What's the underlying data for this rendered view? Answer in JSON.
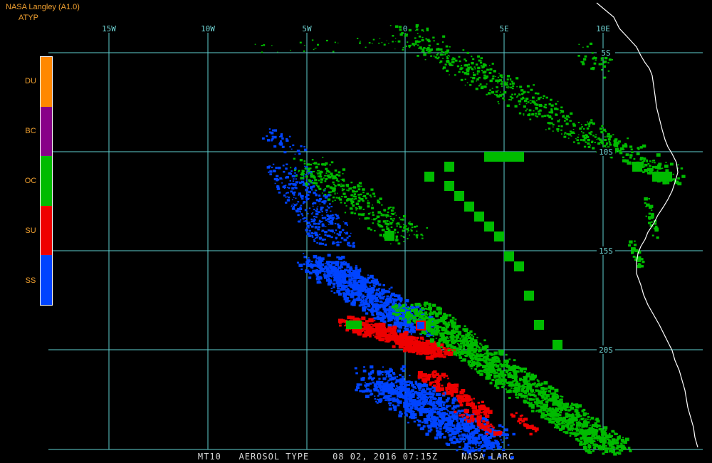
{
  "header": {
    "source_label": "NASA Langley (A1.0)",
    "product_label": "ATYP"
  },
  "legend": {
    "items": [
      {
        "code": "DU",
        "color": "#ff8800"
      },
      {
        "code": "BC",
        "color": "#880088"
      },
      {
        "code": "OC",
        "color": "#00bb00"
      },
      {
        "code": "SU",
        "color": "#ee0000"
      },
      {
        "code": "SS",
        "color": "#0044ff"
      }
    ]
  },
  "map": {
    "lon_labels": [
      "15W",
      "10W",
      "5W",
      "0",
      "5E",
      "10E"
    ],
    "lat_labels": [
      "5S",
      "10S",
      "15S",
      "20S"
    ],
    "grid_color": "#5fd0d0",
    "coast_color": "#ffffff"
  },
  "footer": {
    "caption": "MT10   AEROSOL TYPE    08 02, 2016 07:15Z    NASA LARC"
  }
}
